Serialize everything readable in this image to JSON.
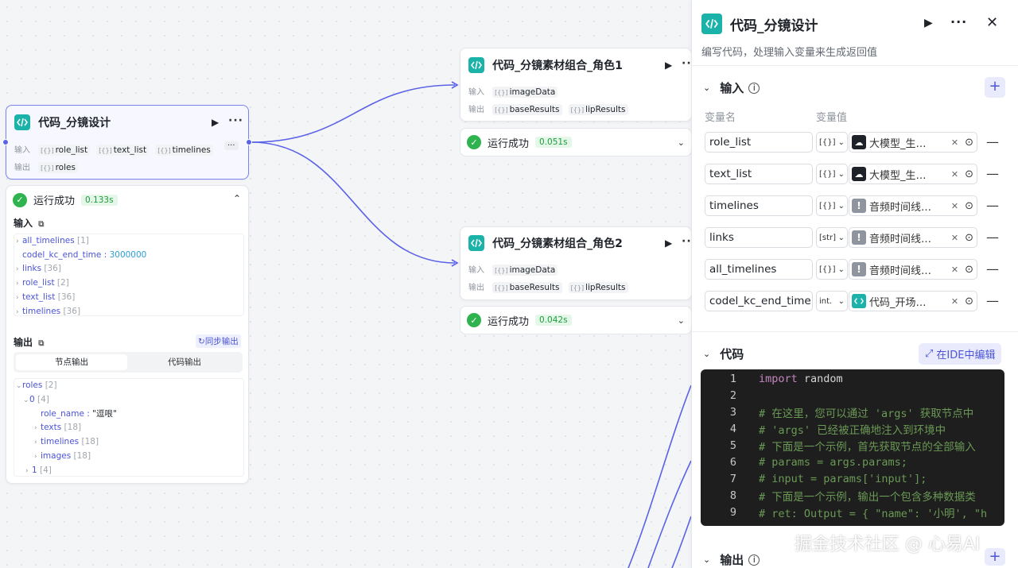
{
  "node_main": {
    "title": "代码_分镜设计",
    "input_label": "输入",
    "output_label": "输出",
    "inputs": [
      "role_list",
      "text_list",
      "timelines"
    ],
    "outputs": [
      "roles"
    ],
    "status": "运行成功",
    "time": "0.133s"
  },
  "node_role1": {
    "title": "代码_分镜素材组合_角色1",
    "input_label": "输入",
    "output_label": "输出",
    "inputs": [
      "imageData"
    ],
    "outputs": [
      "baseResults",
      "lipResults"
    ],
    "status": "运行成功",
    "time": "0.051s"
  },
  "node_role2": {
    "title": "代码_分镜素材组合_角色2",
    "input_label": "输入",
    "output_label": "输出",
    "inputs": [
      "imageData"
    ],
    "outputs": [
      "baseResults",
      "lipResults"
    ],
    "status": "运行成功",
    "time": "0.042s"
  },
  "result": {
    "input_heading": "输入",
    "input_items": [
      {
        "key": "all_timelines",
        "count": "[1]"
      },
      {
        "key": "codel_kc_end_time",
        "value": "3000000"
      },
      {
        "key": "links",
        "count": "[36]"
      },
      {
        "key": "role_list",
        "count": "[2]"
      },
      {
        "key": "text_list",
        "count": "[36]"
      },
      {
        "key": "timelines",
        "count": "[36]"
      }
    ],
    "output_heading": "输出",
    "sync_label": "同步输出",
    "tab_node_output": "节点输出",
    "tab_code_output": "代码输出",
    "roles_key": "roles",
    "roles_count": "[2]",
    "item0_key": "0",
    "item0_count": "[4]",
    "role_name_key": "role_name",
    "role_name_value": "\"逗哏\"",
    "texts_key": "texts",
    "texts_count": "[18]",
    "timelines_key": "timelines",
    "timelines_count": "[18]",
    "images_key": "images",
    "images_count": "[18]",
    "item1_key": "1",
    "item1_count": "[4]"
  },
  "panel": {
    "title": "代码_分镜设计",
    "description": "编写代码，处理输入变量来生成返回值",
    "input_section": "输入",
    "col_name": "变量名",
    "col_value": "变量值",
    "variables": [
      {
        "name": "role_list",
        "type": "[{}]",
        "source_icon": "llm-icon",
        "source": "大模型_生…"
      },
      {
        "name": "text_list",
        "type": "[{}]",
        "source_icon": "llm-icon",
        "source": "大模型_生…"
      },
      {
        "name": "timelines",
        "type": "[{}]",
        "source_icon": "audio-icon",
        "source": "音频时间线…"
      },
      {
        "name": "links",
        "type": "[str]",
        "source_icon": "audio-icon",
        "source": "音频时间线…"
      },
      {
        "name": "all_timelines",
        "type": "[{}]",
        "source_icon": "audio-icon",
        "source": "音频时间线…"
      },
      {
        "name": "codel_kc_end_time",
        "type": "int.",
        "source_icon": "code-icon",
        "source": "代码_开场…"
      }
    ],
    "code_section": "代码",
    "ide_button": "在IDE中编辑",
    "output_section": "输出"
  },
  "code_lines": [
    {
      "n": "1",
      "text": "import random"
    },
    {
      "n": "2",
      "text": ""
    },
    {
      "n": "3",
      "text": "# 在这里，您可以通过 'args'  获取节点中"
    },
    {
      "n": "4",
      "text": "# 'args' 已经被正确地注入到环境中"
    },
    {
      "n": "5",
      "text": "# 下面是一个示例，首先获取节点的全部输入"
    },
    {
      "n": "6",
      "text": "# params = args.params;"
    },
    {
      "n": "7",
      "text": "# input = params['input'];"
    },
    {
      "n": "8",
      "text": "# 下面是一个示例，输出一个包含多种数据类"
    },
    {
      "n": "9",
      "text": "# ret: Output =  { \"name\": '小明', \"h"
    }
  ],
  "watermark": "掘金技术社区 @ 心易AI"
}
